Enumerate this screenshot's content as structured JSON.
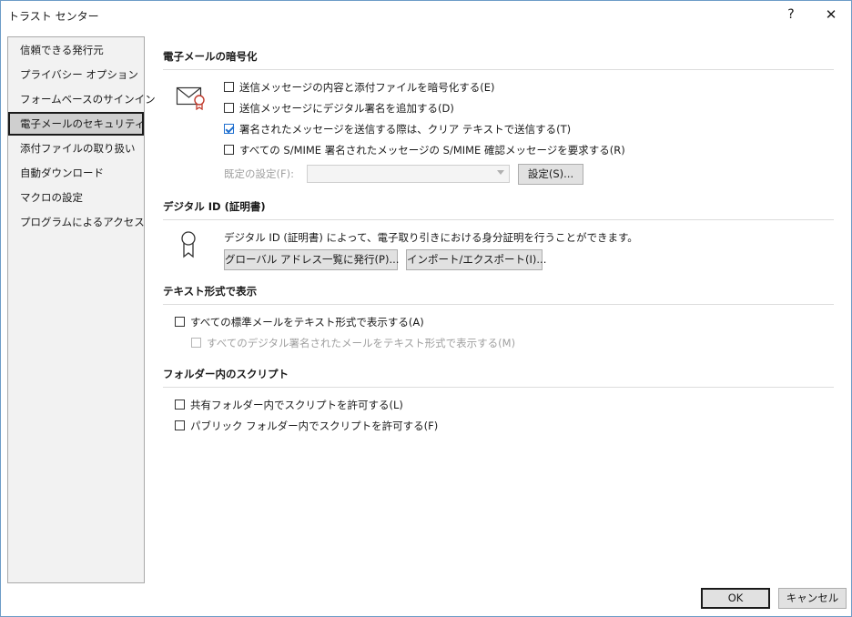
{
  "window": {
    "title": "トラスト センター",
    "help_label": "?",
    "close_label": "✕"
  },
  "sidebar": {
    "items": [
      {
        "label": "信頼できる発行元"
      },
      {
        "label": "プライバシー オプション"
      },
      {
        "label": "フォームベースのサインイン"
      },
      {
        "label": "電子メールのセキュリティ"
      },
      {
        "label": "添付ファイルの取り扱い"
      },
      {
        "label": "自動ダウンロード"
      },
      {
        "label": "マクロの設定"
      },
      {
        "label": "プログラムによるアクセス"
      }
    ],
    "selected_index": 3
  },
  "encryption": {
    "title": "電子メールの暗号化",
    "icon": "envelope-certificate-icon",
    "options": [
      {
        "label": "送信メッセージの内容と添付ファイルを暗号化する(E)",
        "checked": false
      },
      {
        "label": "送信メッセージにデジタル署名を追加する(D)",
        "checked": false
      },
      {
        "label": "署名されたメッセージを送信する際は、クリア テキストで送信する(T)",
        "checked": true
      },
      {
        "label": "すべての S/MIME 署名されたメッセージの S/MIME 確認メッセージを要求する(R)",
        "checked": false
      }
    ],
    "default_setting_label": "既定の設定(F):",
    "default_setting_value": "",
    "settings_button": "設定(S)..."
  },
  "digital_id": {
    "title": "デジタル ID (証明書)",
    "icon": "certificate-ribbon-icon",
    "description": "デジタル ID (証明書) によって、電子取り引きにおける身分証明を行うことができます。",
    "publish_button": "グローバル アドレス一覧に発行(P)...",
    "import_export_button": "インポート/エクスポート(I)..."
  },
  "plain_text": {
    "title": "テキスト形式で表示",
    "options": [
      {
        "label": "すべての標準メールをテキスト形式で表示する(A)",
        "checked": false,
        "disabled": false
      },
      {
        "label": "すべてのデジタル署名されたメールをテキスト形式で表示する(M)",
        "checked": false,
        "disabled": true
      }
    ]
  },
  "folder_script": {
    "title": "フォルダー内のスクリプト",
    "options": [
      {
        "label": "共有フォルダー内でスクリプトを許可する(L)",
        "checked": false
      },
      {
        "label": "パブリック フォルダー内でスクリプトを許可する(F)",
        "checked": false
      }
    ]
  },
  "footer": {
    "ok": "OK",
    "cancel": "キャンセル"
  }
}
